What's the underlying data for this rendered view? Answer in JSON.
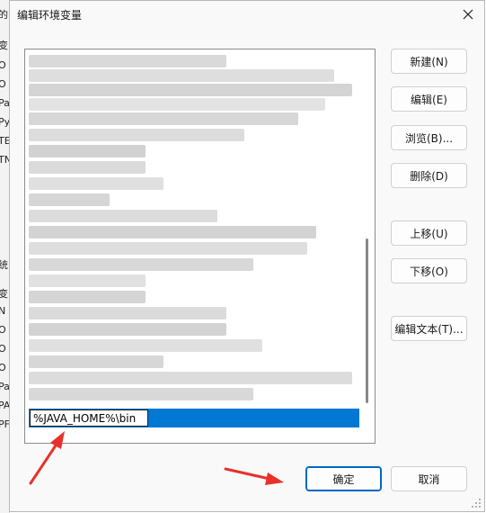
{
  "dialog": {
    "title": "编辑环境变量",
    "close_label": "✕"
  },
  "background_window": {
    "chars": [
      "的",
      "变",
      "O",
      "O",
      "Pa",
      "Py",
      "TE",
      "TN",
      "统",
      "变",
      "N",
      "O",
      "O",
      "O",
      "Pa",
      "PA",
      "PF"
    ]
  },
  "list": {
    "selected_value": "%JAVA_HOME%\\bin"
  },
  "buttons": {
    "new": "新建(N)",
    "edit": "编辑(E)",
    "browse": "浏览(B)...",
    "delete": "删除(D)",
    "move_up": "上移(U)",
    "move_down": "下移(O)",
    "edit_text": "编辑文本(T)...",
    "ok": "确定",
    "cancel": "取消"
  },
  "colors": {
    "selection": "#0078d4",
    "annotation_arrow": "#e8312a",
    "ok_border": "#0067c0"
  }
}
